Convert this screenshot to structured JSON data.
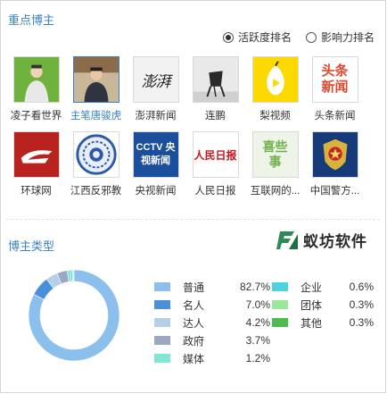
{
  "section_bloggers": {
    "title": "重点博主"
  },
  "rank_options": [
    {
      "label": "活跃度排名",
      "selected": true
    },
    {
      "label": "影响力排名",
      "selected": false
    }
  ],
  "bloggers": [
    {
      "name": "凌子看世界",
      "highlight": false
    },
    {
      "name": "主笔唐骏虎",
      "highlight": true
    },
    {
      "name": "澎湃新闻",
      "highlight": false,
      "logo_text": "澎湃"
    },
    {
      "name": "连鹏",
      "highlight": false
    },
    {
      "name": "梨视频",
      "highlight": false
    },
    {
      "name": "头条新闻",
      "highlight": false,
      "logo_text": "头条新闻"
    },
    {
      "name": "环球网",
      "highlight": false
    },
    {
      "name": "江西反邪教",
      "highlight": false
    },
    {
      "name": "央视新闻",
      "highlight": false,
      "logo_text": "CCTV 央视新闻"
    },
    {
      "name": "人民日报",
      "highlight": false,
      "logo_text": "人民日报"
    },
    {
      "name": "互联网的...",
      "highlight": false,
      "logo_text": "喜些事"
    },
    {
      "name": "中国警方...",
      "highlight": false
    }
  ],
  "section_types": {
    "title": "博主类型"
  },
  "brand": {
    "text": "蚁坊软件",
    "color": "#2e8b57"
  },
  "chart_data": {
    "type": "pie",
    "subtype": "donut",
    "categories": [
      "普通",
      "名人",
      "达人",
      "政府",
      "媒体",
      "企业",
      "团体",
      "其他"
    ],
    "values": [
      82.7,
      7.0,
      4.2,
      3.7,
      1.2,
      0.6,
      0.3,
      0.3
    ],
    "value_labels": [
      "82.7%",
      "7.0%",
      "4.2%",
      "3.7%",
      "1.2%",
      "0.6%",
      "0.3%",
      "0.3%"
    ],
    "colors": [
      "#8cc0ec",
      "#4a8fdc",
      "#b6cfe6",
      "#9ba8c4",
      "#7fe7d2",
      "#4fd2e0",
      "#9be79b",
      "#4cbc4c"
    ],
    "legend_position": "right"
  }
}
